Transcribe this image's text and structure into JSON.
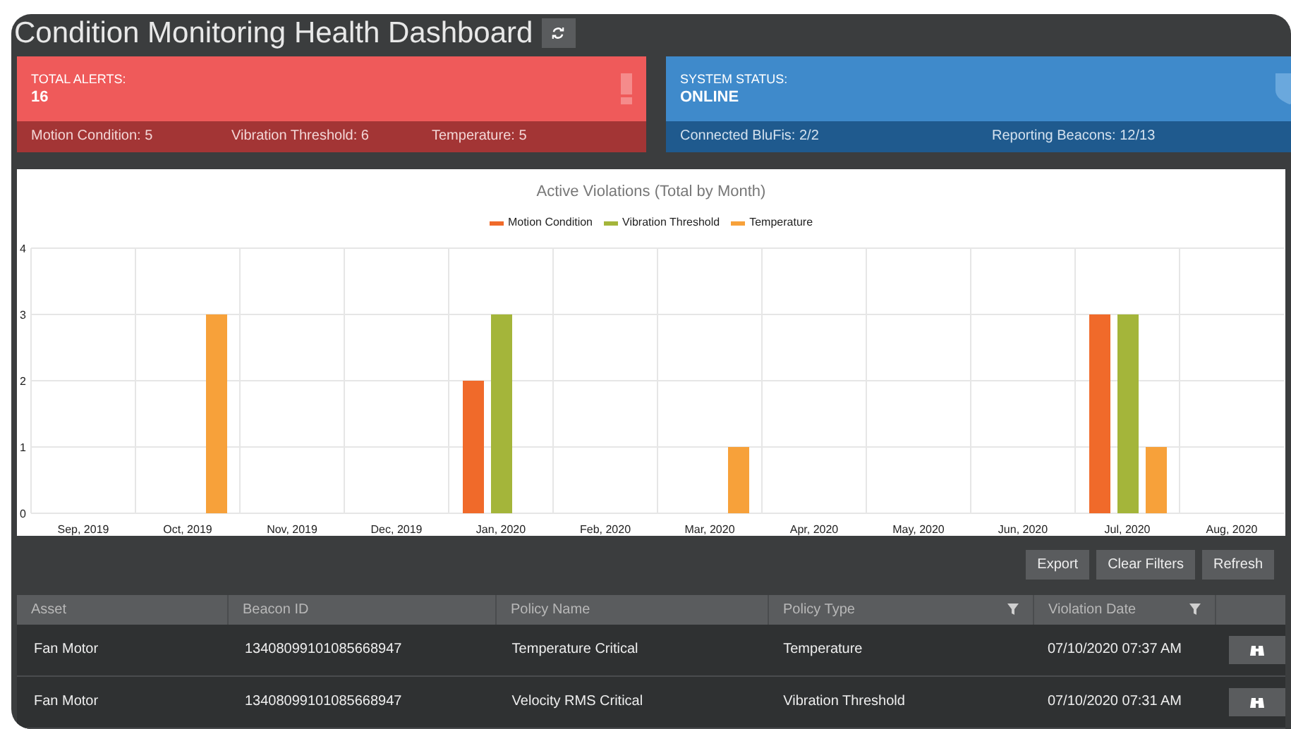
{
  "title": "Condition Monitoring Health Dashboard",
  "cards": [
    {
      "kind": "alert",
      "label": "TOTAL ALERTS:",
      "value": "16",
      "stats": [
        "Motion Condition: 5",
        "Vibration Threshold: 6",
        "Temperature: 5"
      ]
    },
    {
      "kind": "status",
      "label": "SYSTEM STATUS:",
      "value": "ONLINE",
      "stats": [
        "Connected BluFis: 2/2",
        "Reporting Beacons: 12/13"
      ]
    }
  ],
  "chart": {
    "chart_data": {
      "type": "bar",
      "title": "Active Violations (Total by Month)",
      "categories": [
        "Sep, 2019",
        "Oct, 2019",
        "Nov, 2019",
        "Dec, 2019",
        "Jan, 2020",
        "Feb, 2020",
        "Mar, 2020",
        "Apr, 2020",
        "May, 2020",
        "Jun, 2020",
        "Jul, 2020",
        "Aug, 2020"
      ],
      "ylim": [
        0,
        4
      ],
      "grid": true,
      "yticks": [
        0,
        1,
        2,
        3,
        4
      ],
      "series": [
        {
          "name": "Motion Condition",
          "color": "#f06a2a",
          "values": [
            null,
            null,
            null,
            null,
            2,
            null,
            null,
            null,
            null,
            null,
            3,
            null
          ]
        },
        {
          "name": "Vibration Threshold",
          "color": "#a4b53a",
          "values": [
            null,
            null,
            null,
            null,
            3,
            null,
            null,
            null,
            null,
            null,
            3,
            null
          ]
        },
        {
          "name": "Temperature",
          "color": "#f7a13a",
          "values": [
            null,
            3,
            null,
            null,
            null,
            null,
            1,
            null,
            null,
            null,
            1,
            null
          ]
        }
      ]
    }
  },
  "toolbar": [
    "Export",
    "Clear Filters",
    "Refresh"
  ],
  "table": {
    "columns": [
      {
        "label": "Asset",
        "filterable": false
      },
      {
        "label": "Beacon ID",
        "filterable": false
      },
      {
        "label": "Policy Name",
        "filterable": false
      },
      {
        "label": "Policy Type",
        "filterable": true
      },
      {
        "label": "Violation Date",
        "filterable": true
      }
    ],
    "rows": [
      [
        "Fan Motor",
        "13408099101085668947",
        "Temperature Critical",
        "Temperature",
        "07/10/2020 07:37 AM"
      ],
      [
        "Fan Motor",
        "13408099101085668947",
        "Velocity RMS Critical",
        "Vibration Threshold",
        "07/10/2020 07:31 AM"
      ]
    ]
  }
}
